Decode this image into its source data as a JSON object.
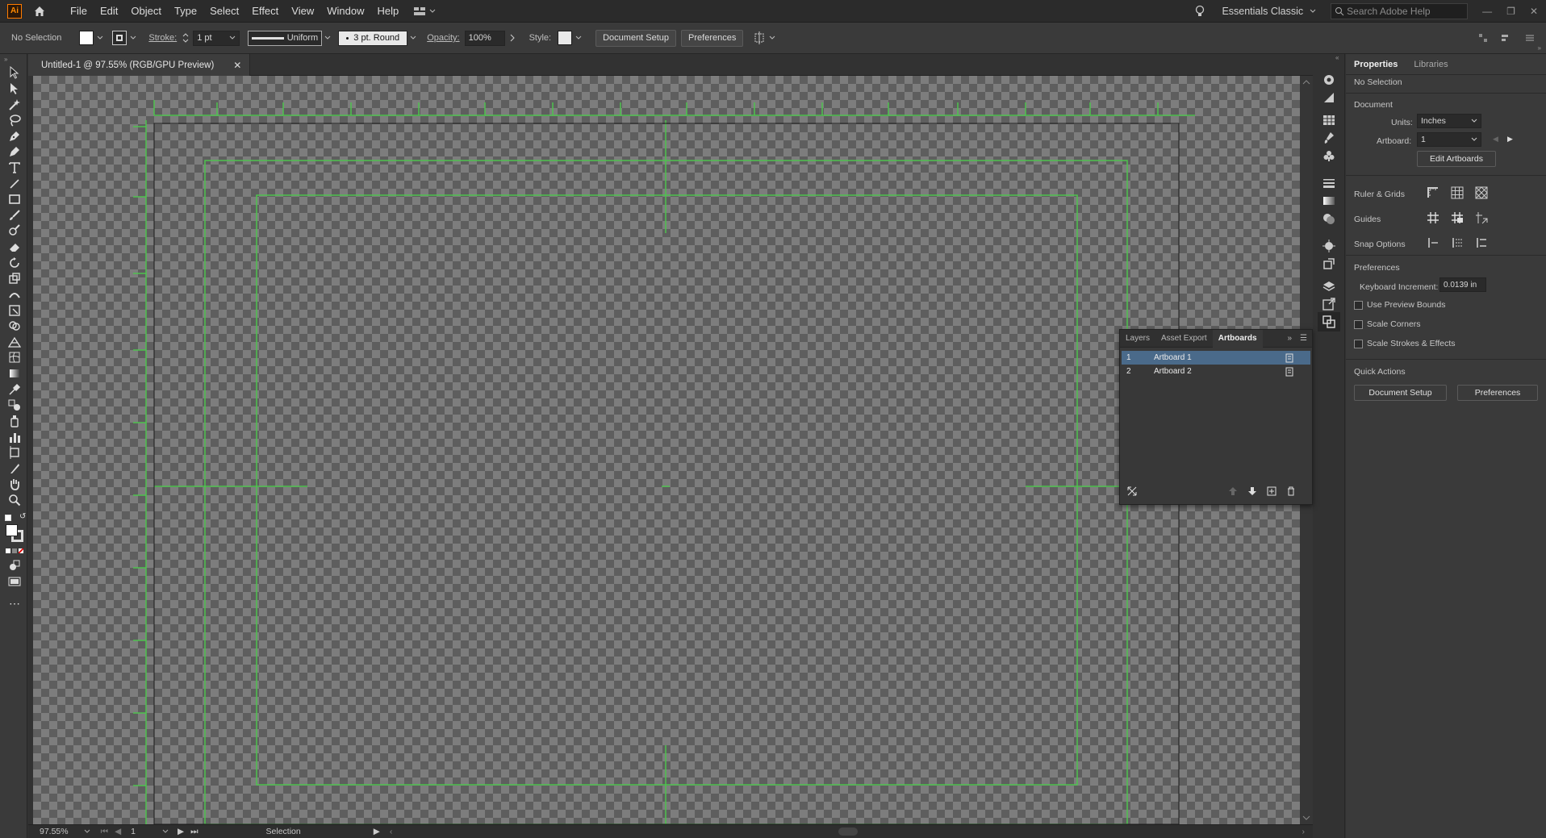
{
  "app": {
    "logo": "Ai",
    "menus": [
      "File",
      "Edit",
      "Object",
      "Type",
      "Select",
      "Effect",
      "View",
      "Window",
      "Help"
    ],
    "workspace": "Essentials Classic",
    "search_placeholder": "Search Adobe Help"
  },
  "control_bar": {
    "selection": "No Selection",
    "stroke_label": "Stroke:",
    "stroke_value": "1 pt",
    "profile": "Uniform",
    "brush": "3 pt. Round",
    "opacity_label": "Opacity:",
    "opacity_value": "100%",
    "style_label": "Style:",
    "doc_setup": "Document Setup",
    "preferences": "Preferences"
  },
  "document_tab": {
    "title": "Untitled-1 @ 97.55% (RGB/GPU Preview)"
  },
  "status_bar": {
    "zoom": "97.55%",
    "artboard_num": "1",
    "tool": "Selection"
  },
  "properties_panel": {
    "tabs": [
      "Properties",
      "Libraries"
    ],
    "selection_state": "No Selection",
    "document_heading": "Document",
    "units_label": "Units:",
    "units_value": "Inches",
    "artboard_label": "Artboard:",
    "artboard_value": "1",
    "edit_artboards": "Edit Artboards",
    "ruler_grids": "Ruler & Grids",
    "guides": "Guides",
    "snap_options": "Snap Options",
    "preferences_heading": "Preferences",
    "keyboard_increment_label": "Keyboard Increment:",
    "keyboard_increment_value": "0.0139 in",
    "use_preview_bounds": "Use Preview Bounds",
    "scale_corners": "Scale Corners",
    "scale_strokes": "Scale Strokes & Effects",
    "quick_actions": "Quick Actions",
    "qa_doc_setup": "Document Setup",
    "qa_preferences": "Preferences"
  },
  "artboards_panel": {
    "tabs": [
      "Layers",
      "Asset Export",
      "Artboards"
    ],
    "rows": [
      {
        "num": "1",
        "name": "Artboard 1"
      },
      {
        "num": "2",
        "name": "Artboard 2"
      }
    ]
  },
  "colors": {
    "guide_green": "#4fc24f",
    "canvas_dark": "#5e5e5e",
    "canvas_light": "#7d7d7d",
    "selection": "#4a6a8a"
  }
}
